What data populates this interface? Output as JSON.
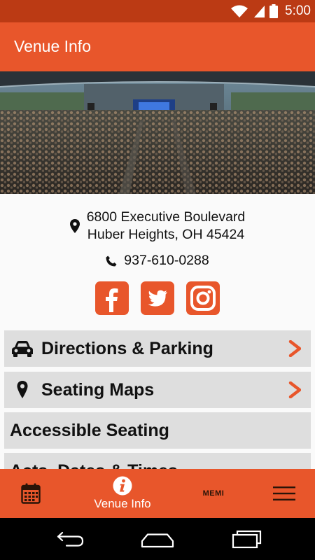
{
  "status_bar": {
    "time": "5:00",
    "icons": [
      "wifi-icon",
      "cell-signal-icon",
      "battery-icon"
    ]
  },
  "app_bar": {
    "title": "Venue Info"
  },
  "hero": {
    "description": "concert-crowd-photo"
  },
  "venue": {
    "address_line1": "6800 Executive Boulevard",
    "address_line2": "Huber Heights, OH 45424",
    "phone": "937-610-0288"
  },
  "socials": [
    "facebook-icon",
    "twitter-icon",
    "instagram-icon"
  ],
  "menu": [
    {
      "label": "Directions & Parking",
      "icon": "car-icon",
      "chevron": true
    },
    {
      "label": "Seating Maps",
      "icon": "map-pin-icon",
      "chevron": true
    },
    {
      "label": "Accessible Seating",
      "icon": null,
      "chevron": false
    },
    {
      "label": "Acts, Dates & Times",
      "icon": null,
      "chevron": false
    }
  ],
  "bottom_nav": {
    "calendar_icon": "calendar-icon",
    "venue_info_label": "Venue Info",
    "logo_text": "MEMI",
    "menu_icon": "hamburger-icon"
  },
  "colors": {
    "brand": "#e8562b",
    "status_bar": "#bb3a14",
    "menu_bg": "#dedede"
  }
}
